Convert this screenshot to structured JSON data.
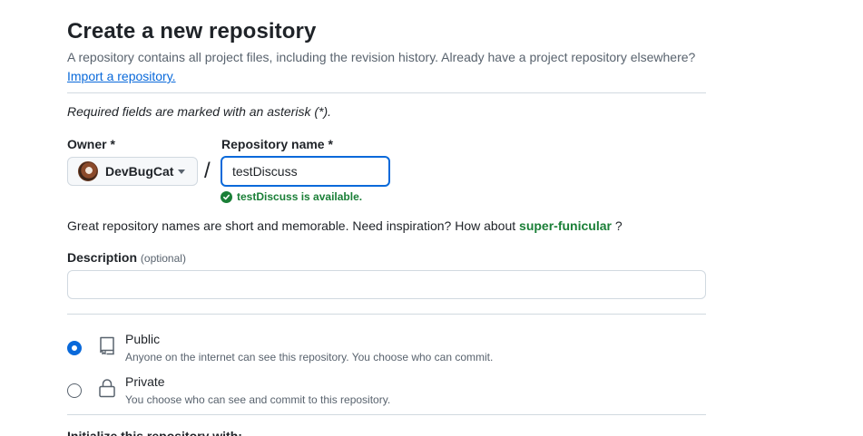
{
  "header": {
    "title": "Create a new repository",
    "subtitle": "A repository contains all project files, including the revision history. Already have a project repository elsewhere?",
    "import_link": "Import a repository."
  },
  "form": {
    "required_note": "Required fields are marked with an asterisk (*).",
    "owner": {
      "label": "Owner *",
      "value": "DevBugCat"
    },
    "separator": "/",
    "repo_name": {
      "label": "Repository name *",
      "value": "testDiscuss",
      "availability": "testDiscuss is available."
    },
    "inspiration": {
      "text": "Great repository names are short and memorable. Need inspiration? How about",
      "suggestion": "super-funicular",
      "suffix": "?"
    },
    "description": {
      "label": "Description",
      "optional": "(optional)",
      "value": ""
    },
    "visibility": {
      "selected": "public",
      "options": [
        {
          "title": "Public",
          "desc": "Anyone on the internet can see this repository. You choose who can commit.",
          "icon": "repo-icon"
        },
        {
          "title": "Private",
          "desc": "You choose who can see and commit to this repository.",
          "icon": "lock-icon"
        }
      ]
    },
    "next_section_label": "Initialize this repository with:"
  },
  "colors": {
    "accent": "#0969da",
    "success": "#1a7f37",
    "muted": "#59636e",
    "border": "#d1d9e0"
  }
}
